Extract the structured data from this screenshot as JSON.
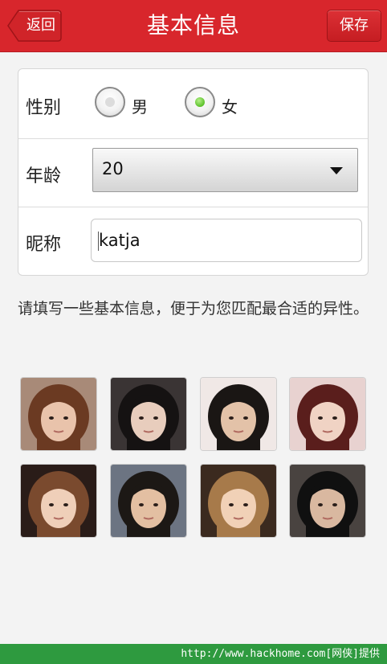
{
  "header": {
    "title": "基本信息",
    "back_label": "返回",
    "save_label": "保存"
  },
  "form": {
    "gender": {
      "label": "性别",
      "options": [
        "男",
        "女"
      ],
      "selected": "女"
    },
    "age": {
      "label": "年龄",
      "value": "20"
    },
    "nickname": {
      "label": "昵称",
      "value": "katja"
    }
  },
  "info_text": "请填写一些基本信息，便于为您匹配最合适的异性。",
  "photos": [
    {
      "name": "photo-1",
      "hair": "#6b3a22",
      "bg": "#a88a78",
      "skin": "#e9c3ab"
    },
    {
      "name": "photo-2",
      "hair": "#151212",
      "bg": "#3a3434",
      "skin": "#e8cdbd"
    },
    {
      "name": "photo-3",
      "hair": "#1a1614",
      "bg": "#f0e8e6",
      "skin": "#e3c2a8"
    },
    {
      "name": "photo-4",
      "hair": "#5a1e1c",
      "bg": "#e8d2d0",
      "skin": "#f0d3c4"
    },
    {
      "name": "photo-5",
      "hair": "#7a4a2e",
      "bg": "#2a1c18",
      "skin": "#efcfb9"
    },
    {
      "name": "photo-6",
      "hair": "#1c1815",
      "bg": "#6c7482",
      "skin": "#e3bfa2"
    },
    {
      "name": "photo-7",
      "hair": "#a77a4a",
      "bg": "#3b2a1f",
      "skin": "#f1d1b7"
    },
    {
      "name": "photo-8",
      "hair": "#101010",
      "bg": "#494340",
      "skin": "#d9b8a0"
    }
  ],
  "watermark": "http://www.hackhome.com[网侠]提供",
  "colors": {
    "header_red": "#d8262c",
    "radio_green": "#5cc12a",
    "footer_green": "#2e9a3f"
  }
}
